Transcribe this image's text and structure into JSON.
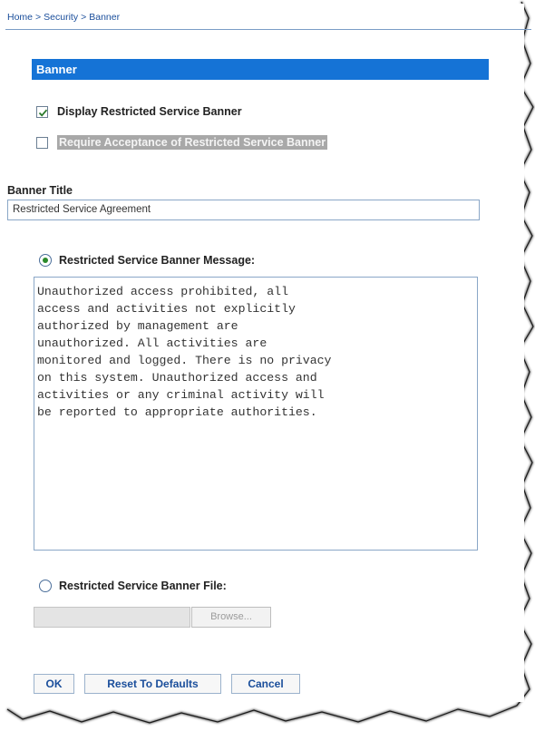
{
  "breadcrumb": {
    "items": [
      "Home",
      "Security",
      "Banner"
    ],
    "separator": ">"
  },
  "section": {
    "title": "Banner"
  },
  "options": {
    "display_banner": {
      "label": "Display Restricted Service Banner",
      "checked": true
    },
    "require_acceptance": {
      "label": "Require Acceptance of Restricted Service Banner",
      "checked": false,
      "disabled": true
    }
  },
  "banner_title": {
    "label": "Banner Title",
    "value": "Restricted Service Agreement"
  },
  "message_option": {
    "label": "Restricted Service Banner Message:",
    "selected": true,
    "text": "Unauthorized access prohibited, all\naccess and activities not explicitly\nauthorized by management are\nunauthorized. All activities are\nmonitored and logged. There is no privacy\non this system. Unauthorized access and\nactivities or any criminal activity will\nbe reported to appropriate authorities."
  },
  "file_option": {
    "label": "Restricted Service Banner File:",
    "selected": false,
    "file_value": "",
    "browse_label": "Browse..."
  },
  "buttons": {
    "ok": "OK",
    "reset": "Reset To Defaults",
    "cancel": "Cancel"
  },
  "colors": {
    "header_bg": "#1573d6",
    "link": "#1a4e9b",
    "radio_dot": "#2b8a2b"
  }
}
